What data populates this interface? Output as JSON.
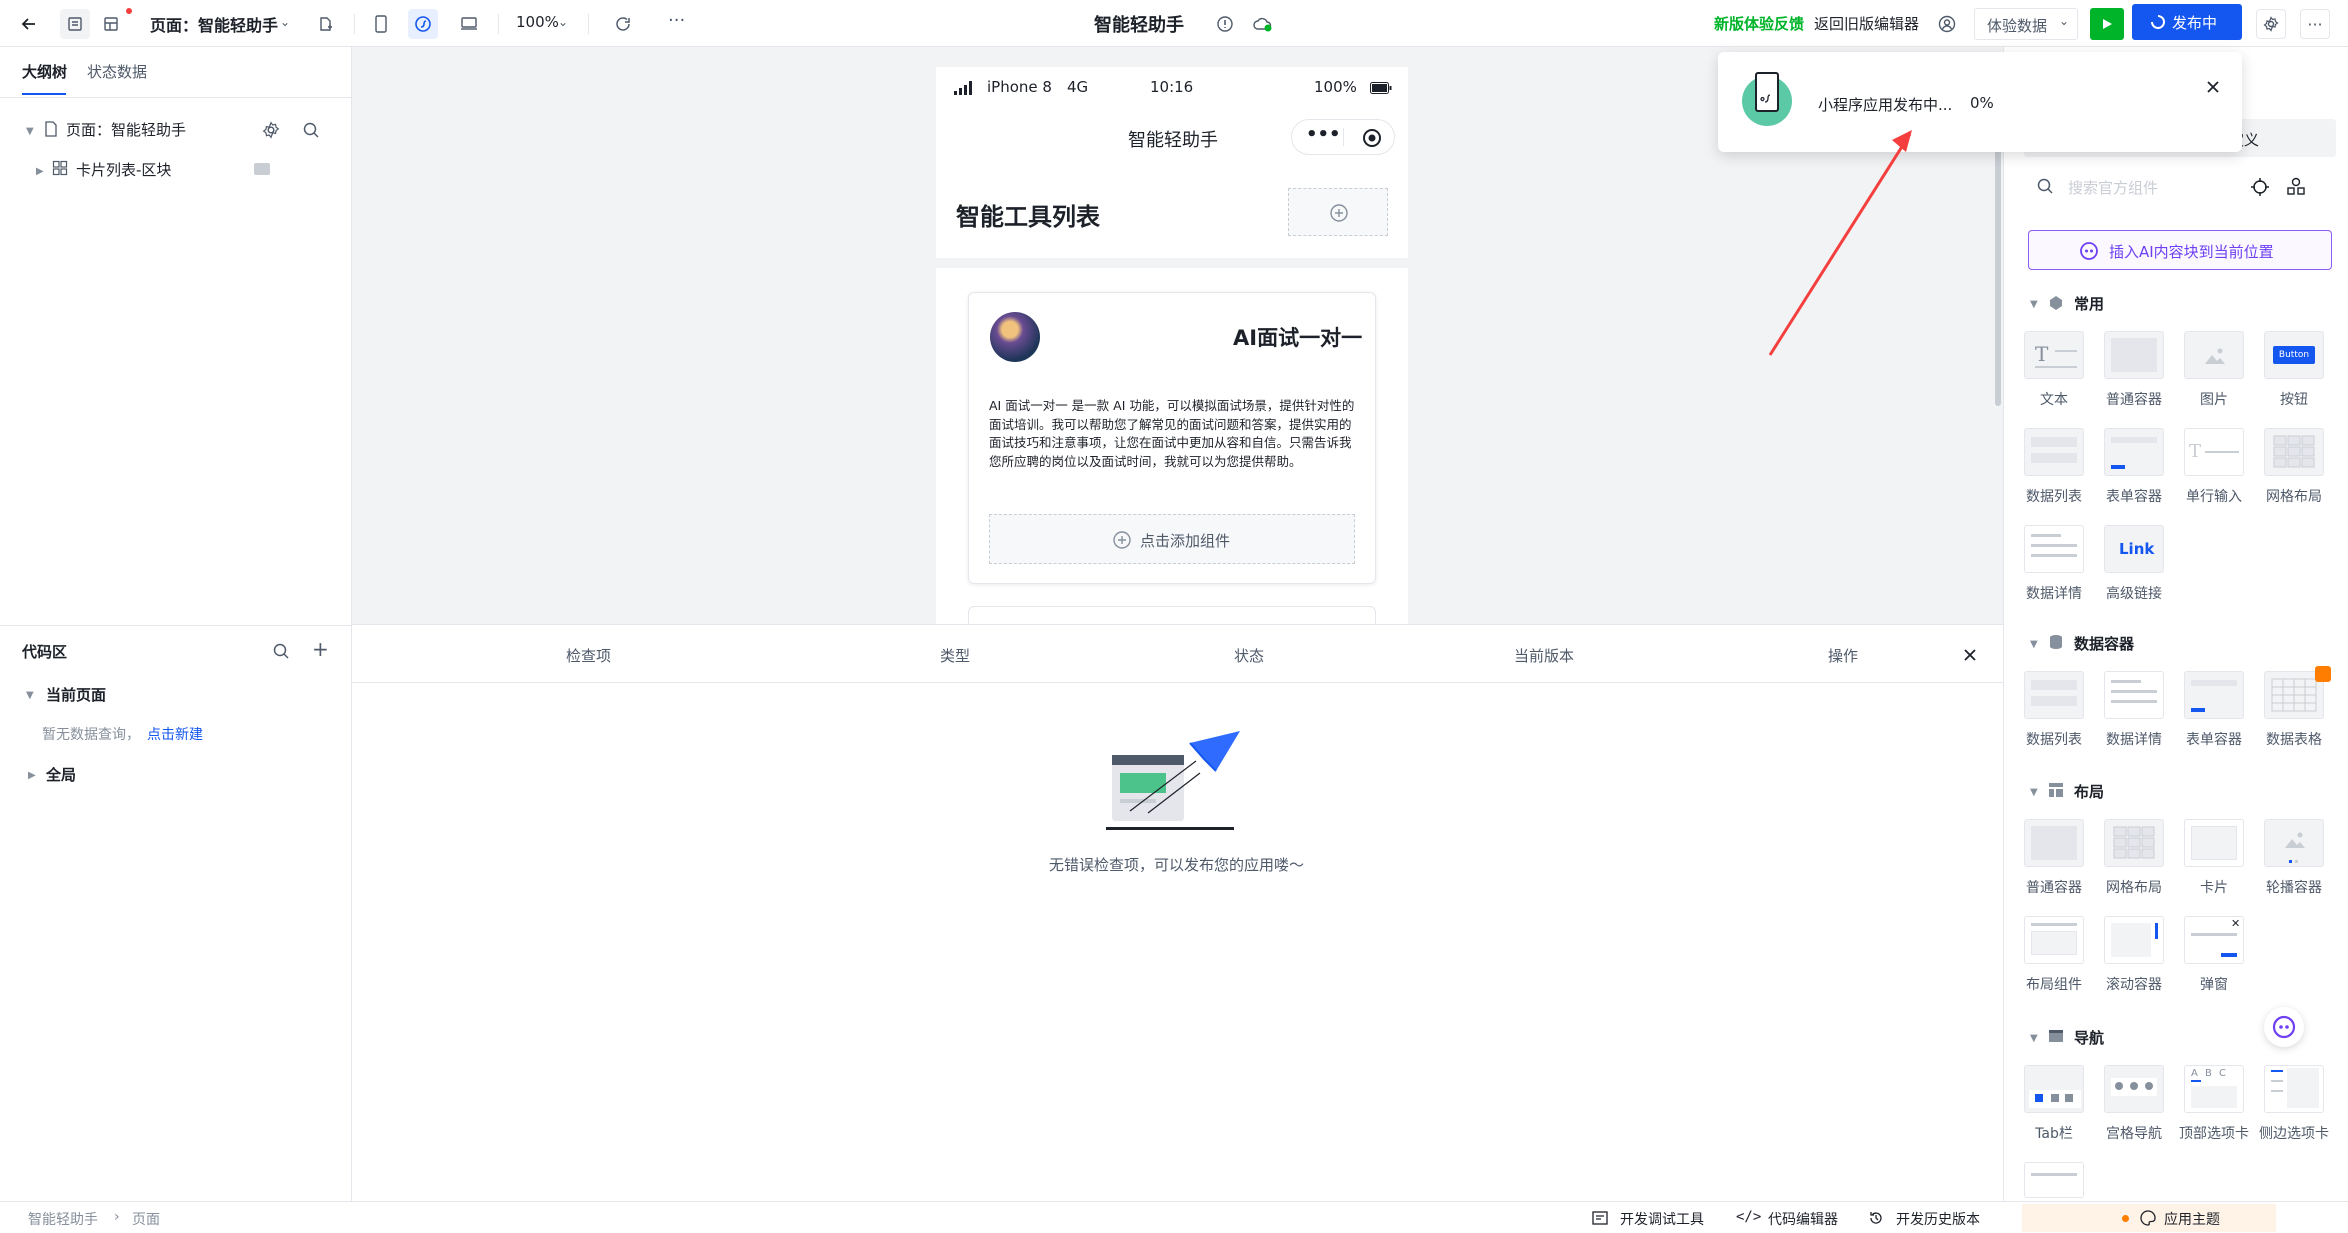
{
  "topbar": {
    "page_label": "页面：智能轻助手",
    "zoom": "100%",
    "app_title": "智能轻助手",
    "feedback": "新版体验反馈",
    "back_old": "返回旧版编辑器",
    "data_mode": "体验数据",
    "publish": "发布中",
    "more": "···"
  },
  "left": {
    "tabs": [
      "大纲树",
      "状态数据"
    ],
    "tree": {
      "page": "页面：智能轻助手",
      "block": "卡片列表-区块"
    },
    "code": {
      "title": "代码区",
      "current_page": "当前页面",
      "empty_text": "暂无数据查询，",
      "create_link": "点击新建",
      "global": "全局"
    }
  },
  "phone": {
    "carrier": "iPhone 8",
    "network": "4G",
    "time": "10:16",
    "battery": "100%",
    "nav_title": "智能轻助手",
    "list_title": "智能工具列表",
    "card": {
      "title": "AI面试一对一",
      "desc": "AI 面试一对一 是一款 AI 功能，可以模拟面试场景，提供针对性的面试培训。我可以帮助您了解常见的面试问题和答案，提供实用的面试技巧和注意事项，让您在面试中更加从容和自信。只需告诉我您所应聘的岗位以及面试时间，我就可以为您提供帮助。",
      "add_component": "点击添加组件"
    }
  },
  "check": {
    "columns": [
      "检查项",
      "类型",
      "状态",
      "当前版本",
      "操作"
    ],
    "empty_message": "无错误检查项，可以发布您的应用喽～"
  },
  "right": {
    "tab_custom": "自定义",
    "search_placeholder": "搜索官方组件",
    "ai_insert": "插入AI内容块到当前位置",
    "sections": {
      "common": {
        "title": "常用",
        "items": [
          "文本",
          "普通容器",
          "图片",
          "按钮",
          "数据列表",
          "表单容器",
          "单行输入",
          "网格布局",
          "数据详情",
          "高级链接"
        ]
      },
      "data": {
        "title": "数据容器",
        "items": [
          "数据列表",
          "数据详情",
          "表单容器",
          "数据表格"
        ]
      },
      "layout": {
        "title": "布局",
        "items": [
          "普通容器",
          "网格布局",
          "卡片",
          "轮播容器",
          "布局组件",
          "滚动容器",
          "弹窗"
        ]
      },
      "nav": {
        "title": "导航",
        "items": [
          "Tab栏",
          "宫格导航",
          "顶部选项卡",
          "侧边选项卡"
        ]
      }
    },
    "button_thumb": "Button",
    "link_thumb": "Link",
    "tab_thumb": "A B C"
  },
  "statusbar": {
    "breadcrumb": [
      "智能轻助手",
      "页面"
    ],
    "dev_tools": "开发调试工具",
    "code_editor": "代码编辑器",
    "history": "开发历史版本",
    "theme": "应用主题"
  },
  "toast": {
    "message": "小程序应用发布中...",
    "progress": "0%"
  },
  "colors": {
    "primary": "#1456f0",
    "green": "#00b42a",
    "annotation_red": "#f53f3f"
  }
}
